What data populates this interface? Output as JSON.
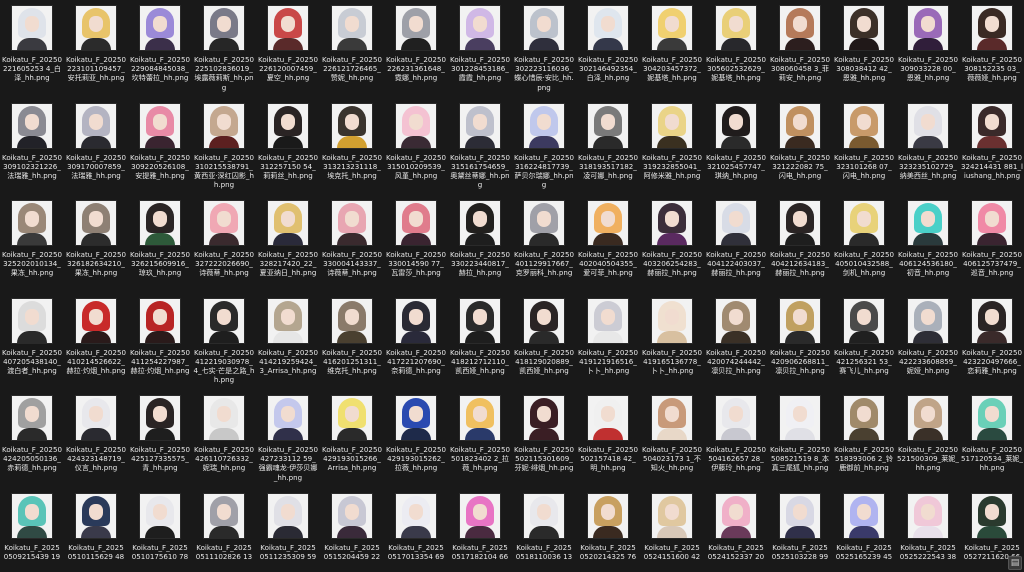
{
  "view": {
    "background": "#191919",
    "thumbnail_background": "#f2f2f2",
    "columns": 16,
    "rows_visible": 6
  },
  "files": [
    {
      "name": "Koikatu_F_20250221605253 4_白泽_hh.png",
      "hair": "#dfe3ea",
      "body": "#3a3a40"
    },
    {
      "name": "Koikatu_F_20250223101109457_安托莉亚_hh.png",
      "hair": "#e8c46a",
      "body": "#2b2b2b"
    },
    {
      "name": "Koikatu_F_20250229084845038_坎特蕾拉_hh.png",
      "hair": "#9b8ad8",
      "body": "#3b2f4a"
    },
    {
      "name": "Koikatu_F_20250225102836019_埃露薇莉斯_hh.png",
      "hair": "#7a7a88",
      "body": "#262626"
    },
    {
      "name": "Koikatu_F_20250226120007459_夏空_hh.png",
      "hair": "#c94848",
      "body": "#5a2a2a"
    },
    {
      "name": "Koikatu_F_20250226121726465_赞妮_hh.png",
      "hair": "#c8ccd4",
      "body": "#3a3a3a"
    },
    {
      "name": "Koikatu_F_20250226231361648_霓娜_hh.png",
      "hair": "#9ea0a8",
      "body": "#202020"
    },
    {
      "name": "Koikatu_F_20250301228453186_霞霞_hh.png",
      "hair": "#d0b8e6",
      "body": "#4a3e60"
    },
    {
      "name": "Koikatu_F_20250302223116036_蝶心惜辰·安比_hh.png",
      "hair": "#bcc2cc",
      "body": "#2f2f3c"
    },
    {
      "name": "Koikatu_F_20250302146492354_白泽_hh.png",
      "hair": "#dfe6ee",
      "body": "#34384a"
    },
    {
      "name": "Koikatu_F_20250304203457372_妮基塔_hh.png",
      "hair": "#f0d070",
      "body": "#3a3a3a"
    },
    {
      "name": "Koikatu_F_20250305602532629_妮基塔_hh.png",
      "hair": "#e9cf78",
      "body": "#28282c"
    },
    {
      "name": "Koikatu_F_20250308060458 3_菲莉安_hh.png",
      "hair": "#b57a5a",
      "body": "#2c1e1e"
    },
    {
      "name": "Koikatu_F_20250308038412 42_恩雅_hh.png",
      "hair": "#3c3028",
      "body": "#201818"
    },
    {
      "name": "Koikatu_F_20250309033228 00_恩雅_hh.png",
      "hair": "#9a6ab8",
      "body": "#301e3a"
    },
    {
      "name": "Koikatu_F_20250308152235 03_薇薇娅_hh.png",
      "hair": "#3a2a24",
      "body": "#5a2a2a"
    },
    {
      "name": "Koikatu_F_20250309102321226_法瑞雅_hh.png",
      "hair": "#8a8a92",
      "body": "#222228"
    },
    {
      "name": "Koikatu_F_20250309170007859_法瑞雅_hh.png",
      "hair": "#b4b4c2",
      "body": "#2a2a30"
    },
    {
      "name": "Koikatu_F_20250309220526108_安提雅_hh.png",
      "hair": "#e88aa6",
      "body": "#3a2430"
    },
    {
      "name": "Koikatu_F_20250310215538791_黄西亚·深红囚影_hh.png",
      "hair": "#c4a890",
      "body": "#5c2020"
    },
    {
      "name": "Koikatu_F_20250312257150 54_莉莉丝_hh.png",
      "hair": "#2a2424",
      "body": "#1a1a1a"
    },
    {
      "name": "Koikatu_F_20250313213231118_埃克托_hh.png",
      "hair": "#3a342e",
      "body": "#d2a030"
    },
    {
      "name": "Koikatu_F_20250315010209539_风堇_hh.png",
      "hair": "#f4c2d2",
      "body": "#3a2a34"
    },
    {
      "name": "Koikatu_F_20250315161754659_奥黛丝蒂娜_hh.png",
      "hair": "#bec0cc",
      "body": "#2c2c36"
    },
    {
      "name": "Koikatu_F_20250316224817739_萨贝尔瑞娜_hh.png",
      "hair": "#c0c8ec",
      "body": "#3c3a60"
    },
    {
      "name": "Koikatu_F_20250318193517182_凌可娜_hh.png",
      "hair": "#7a7a7a",
      "body": "#2a2a2a"
    },
    {
      "name": "Koikatu_F_20250319232855041_阿修米雅_hh.png",
      "hair": "#ead488",
      "body": "#3a3020"
    },
    {
      "name": "Koikatu_F_20250321025457747_琪纳_hh.png",
      "hair": "#201c1c",
      "body": "#2a2a2a"
    },
    {
      "name": "Koikatu_F_20250321222082 75_闪电_hh.png",
      "hair": "#c09060",
      "body": "#3a2a20"
    },
    {
      "name": "Koikatu_F_20250323101268 07_闪电_hh.png",
      "hair": "#c89a6a",
      "body": "#7a5a30"
    },
    {
      "name": "Koikatu_F_20250323235102729_纳美西丝_hh.png",
      "hair": "#e0e0e6",
      "body": "#3a3a44"
    },
    {
      "name": "Koikatu_F_20250324214431 881_liushang_hh.png",
      "hair": "#3a2a2a",
      "body": "#6a3030"
    },
    {
      "name": "Koikatu_F_20250325202010134_果冻_hh.png",
      "hair": "#9a8878",
      "body": "#3a3a3a"
    },
    {
      "name": "Koikatu_F_20250326182634210_果冻_hh.png",
      "hair": "#8e8074",
      "body": "#2c2c2c"
    },
    {
      "name": "Koikatu_F_20250326215609916_琼玖_hh.png",
      "hair": "#2a2424",
      "body": "#2e5a3a"
    },
    {
      "name": "Koikatu_F_20250327222026690_诗薇蒂_hh.png",
      "hair": "#f0a8b4",
      "body": "#3a2a2e"
    },
    {
      "name": "Koikatu_F_20250328217420_22_夏亚纳日_hh.png",
      "hair": "#e0c070",
      "body": "#2a2a3a"
    },
    {
      "name": "Koikatu_F_20250330004143337_诗薇蒂_hh.png",
      "hair": "#e8a6b2",
      "body": "#3a2a2e"
    },
    {
      "name": "Koikatu_F_20250330014590 77_瓦雷莎_hh.png",
      "hair": "#e07c8c",
      "body": "#3a2430"
    },
    {
      "name": "Koikatu_F_20250330223440817_赫拉_hh.png",
      "hair": "#22201e",
      "body": "#1e1e1e"
    },
    {
      "name": "Koikatu_F_20250401129917667_克罗丽科_hh.png",
      "hair": "#a0a0a8",
      "body": "#2a2a2a"
    },
    {
      "name": "Koikatu_F_20250402040504355_爱可菲_hh.png",
      "hair": "#f0b060",
      "body": "#3a2a20"
    },
    {
      "name": "Koikatu_F_20250403206254283_赫丽拉_hh.png",
      "hair": "#3c2e3a",
      "body": "#5a2a60"
    },
    {
      "name": "Koikatu_F_20250404122403037_赫丽拉_hh.png",
      "hair": "#d8dce6",
      "body": "#30303a"
    },
    {
      "name": "Koikatu_F_20250404212634183_赫丽拉_hh.png",
      "hair": "#2a2424",
      "body": "#1e1e1e"
    },
    {
      "name": "Koikatu_F_20250405010432588_剑机_hh.png",
      "hair": "#e8d27a",
      "body": "#2a2a2a"
    },
    {
      "name": "Koikatu_F_20250406124536180_初音_hh.png",
      "hair": "#4ad0c8",
      "body": "#2a3a3c"
    },
    {
      "name": "Koikatu_F_20250406125737479_巡音_hh.png",
      "hair": "#f08aa6",
      "body": "#3a2430"
    },
    {
      "name": "Koikatu_F_20250407205438140_渡白者_hh.png",
      "hair": "#dcdcdc",
      "body": "#2a2a2a"
    },
    {
      "name": "Koikatu_F_20250410214526622_赫拉·灼烟_hh.png",
      "hair": "#c82a2a",
      "body": "#2a1a1a"
    },
    {
      "name": "Koikatu_F_20250411254227987_赫拉·灼烟_hh.png",
      "hair": "#b82424",
      "body": "#2a1a1a"
    },
    {
      "name": "Koikatu_F_20250412219030978_4_七实·芒是之路_hh.png",
      "hair": "#2a2a2a",
      "body": "#1e1e1e"
    },
    {
      "name": "Koikatu_F_20250414219259424_3_Arrisa_hh.png",
      "hair": "#b4a690",
      "body": "#e6e6e6"
    },
    {
      "name": "Koikatu_F_20250416201251311_维克托_hh.png",
      "hair": "#8a7a6a",
      "body": "#4a4030"
    },
    {
      "name": "Koikatu_F_20250417221207690_奈莉德_hh.png",
      "hair": "#2a2a34",
      "body": "#2a2a3a"
    },
    {
      "name": "Koikatu_F_20250418212712110_凯西娅_hh.png",
      "hair": "#2a2a2a",
      "body": "#1e1e1e"
    },
    {
      "name": "Koikatu_F_20250418129020889_凯西娅_hh.png",
      "hair": "#2a2424",
      "body": "#2a2a2a"
    },
    {
      "name": "Koikatu_F_20250419121916516_卜卜_hh.png",
      "hair": "#ccccd4",
      "body": "#e8e8e8"
    },
    {
      "name": "Koikatu_F_20250419165136778_卜卜_hh.png",
      "hair": "#f0e0d0",
      "body": "#d8c0a0"
    },
    {
      "name": "Koikatu_F_20250420074244442_凛贝拉_hh.png",
      "hair": "#a08a70",
      "body": "#3a3026"
    },
    {
      "name": "Koikatu_F_20250420906268811_凛贝拉_hh.png",
      "hair": "#c0a060",
      "body": "#2a2a2a"
    },
    {
      "name": "Koikatu_F_20250421256321 53_赛飞儿_hh.png",
      "hair": "#4a4a4a",
      "body": "#202020"
    },
    {
      "name": "Koikatu_F_20250422233608859_妮娅_hh.png",
      "hair": "#aab0ba",
      "body": "#2e2e36"
    },
    {
      "name": "Koikatu_F_20250423220497666_恋莉雅_hh.png",
      "hair": "#2a2424",
      "body": "#3a2a2a"
    },
    {
      "name": "Koikatu_F_20250424205050136_赤莉德_hh.png",
      "hair": "#a0a0a0",
      "body": "#2a2a2a"
    },
    {
      "name": "Koikatu_F_20250424323148719_仪言_hh.png",
      "hair": "#e8e8ec",
      "body": "#2a2a30"
    },
    {
      "name": "Koikatu_F_20250425127335575_青_hh.png",
      "hair": "#2a2424",
      "body": "#1e1e1e"
    },
    {
      "name": "Koikatu_F_20250426110726332_妮瑞_hh.png",
      "hair": "#e8e8e8",
      "body": "#c8c8c8"
    },
    {
      "name": "Koikatu_F_20250427233112 59_强霸魂龙·伊莎贝娜_hh.png",
      "hair": "#c4c8ec",
      "body": "#30304a"
    },
    {
      "name": "Koikatu_F_20250429193015266_Arrisa_hh.png",
      "hair": "#f0e070",
      "body": "#2a2a2a"
    },
    {
      "name": "Koikatu_F_20250429193015262_拉薇_hh.png",
      "hair": "#2a4ab0",
      "body": "#1e2a4a"
    },
    {
      "name": "Koikatu_F_20250501823402 2_拉薇_hh.png",
      "hair": "#f0c060",
      "body": "#2a3a6a"
    },
    {
      "name": "Koikatu_F_20250502115301609_芬妮·绯烟_hh.png",
      "hair": "#3a1e24",
      "body": "#3a1e24"
    },
    {
      "name": "Koikatu_F_20250502157418 42_明_hh.png",
      "hair": "#f0f0f0",
      "body": "#c03030"
    },
    {
      "name": "Koikatu_F_20250504023173 1_不知火_hh.png",
      "hair": "#c89a7a",
      "body": "#e8d8c8"
    },
    {
      "name": "Koikatu_F_20250504162657 28_伊藤玲_hh.png",
      "hair": "#e8e8ec",
      "body": "#c8c8d0"
    },
    {
      "name": "Koikatu_F_20250508521519 8_本真三尾狐_hh.png",
      "hair": "#f0f0f4",
      "body": "#e0e0e6"
    },
    {
      "name": "Koikatu_F_20250518393006 2_铃鹿御前_hh.png",
      "hair": "#a08a6a",
      "body": "#4a4030"
    },
    {
      "name": "Koikatu_F_20250521500309_莱妮_hh.png",
      "hair": "#c0a488",
      "body": "#3a3028"
    },
    {
      "name": "Koikatu_F_20250517120534_莱妮_hh.png",
      "hair": "#6ad0b8",
      "body": "#2a4a40"
    },
    {
      "name": "Koikatu_F_2025 0509215439 19",
      "hair": "#5ac4b8",
      "body": "#304a44"
    },
    {
      "name": "Koikatu_F_2025 0510115629 48",
      "hair": "#2a3a5a",
      "body": "#3a3a4a"
    },
    {
      "name": "Koikatu_F_2025 0510175610 78",
      "hair": "#e8e8ec",
      "body": "#1e1e1e"
    },
    {
      "name": "Koikatu_F_2025 0511102826 13",
      "hair": "#a0a0a8",
      "body": "#2a2a2a"
    },
    {
      "name": "Koikatu_F_2025 0511235309 59",
      "hair": "#e0e0e6",
      "body": "#2a2a34"
    },
    {
      "name": "Koikatu_F_2025 0515204459 22",
      "hair": "#c8c8d4",
      "body": "#3a2a3a"
    },
    {
      "name": "Koikatu_F_2025 0517013354 69",
      "hair": "#ececf2",
      "body": "#3a3a4a"
    },
    {
      "name": "Koikatu_F_2025 0517182104 66",
      "hair": "#e874c4",
      "body": "#4a2a40"
    },
    {
      "name": "Koikatu_F_2025 0518110036 13",
      "hair": "#e8e8ec",
      "body": "#2a2a2a"
    },
    {
      "name": "Koikatu_F_2025 0520214325 76",
      "hair": "#c8a060",
      "body": "#3a2a20"
    },
    {
      "name": "Koikatu_F_2025 0524151600 42",
      "hair": "#e0c8a0",
      "body": "#d8c8b8"
    },
    {
      "name": "Koikatu_F_2025 0524152337 20",
      "hair": "#f0b0c8",
      "body": "#6a3a5a"
    },
    {
      "name": "Koikatu_F_2025 0525103228 99",
      "hair": "#d8d8e4",
      "body": "#30304a"
    },
    {
      "name": "Koikatu_F_2025 0525165239 45",
      "hair": "#b0b4f0",
      "body": "#3a3a6a"
    },
    {
      "name": "Koikatu_F_2025 0525222543 38",
      "hair": "#f0c8d8",
      "body": "#e8e0ea"
    },
    {
      "name": "Koikatu_F_2025 0527211620 66",
      "hair": "#2a3a2e",
      "body": "#2a4a3a"
    }
  ]
}
